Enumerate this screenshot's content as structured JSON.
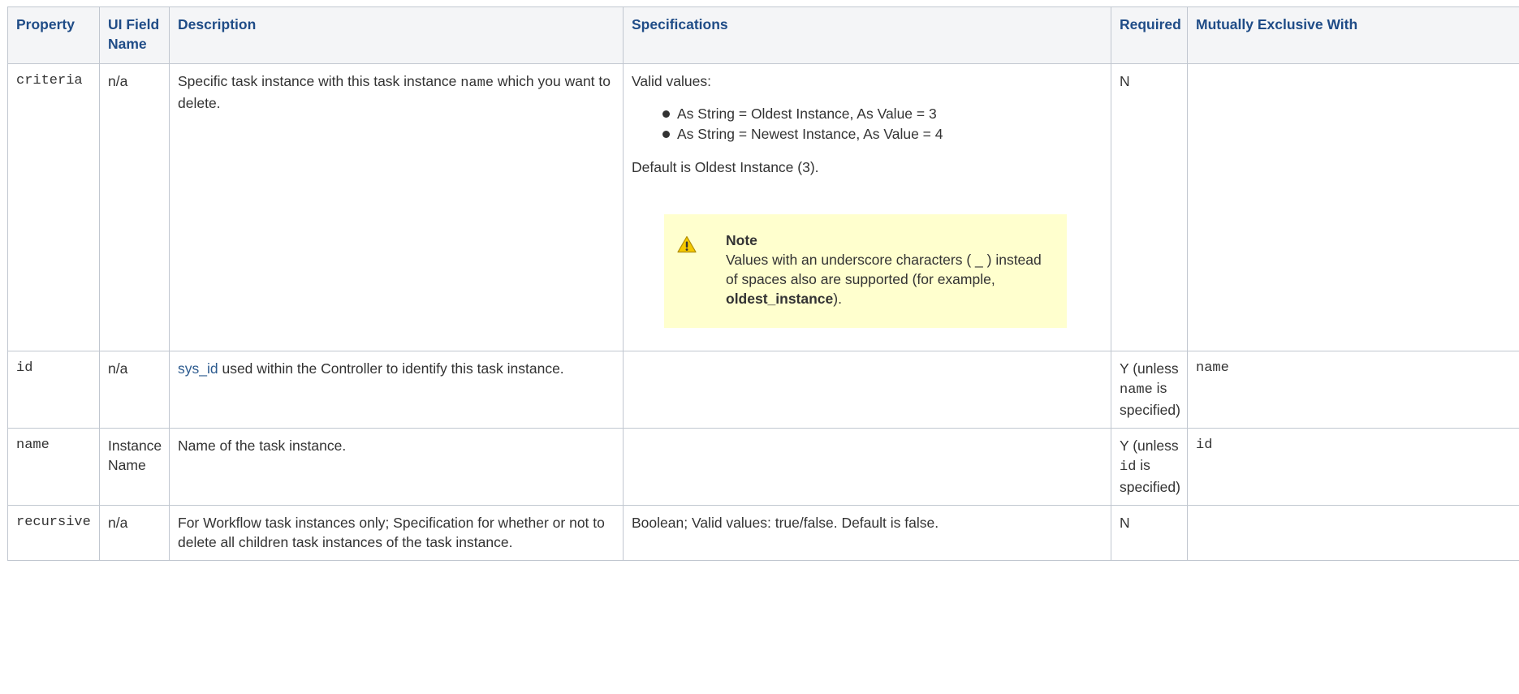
{
  "headers": {
    "property": "Property",
    "ui_field_name": "UI Field Name",
    "description": "Description",
    "specifications": "Specifications",
    "required": "Required",
    "mutually_exclusive": "Mutually Exclusive With"
  },
  "rows": [
    {
      "property": "criteria",
      "ui_field": "n/a",
      "desc_pre": "Specific task instance with this task instance ",
      "desc_code": "name",
      "desc_post": " which you want to delete.",
      "spec_intro": "Valid values:",
      "spec_items": [
        "As String = Oldest Instance, As Value = 3",
        "As String = Newest Instance, As Value = 4"
      ],
      "spec_default": "Default is Oldest Instance (3).",
      "note_title": "Note",
      "note_text_pre": "Values with an underscore characters ( _ ) instead of spaces also are supported (for example, ",
      "note_bold": "oldest_instance",
      "note_text_post": ").",
      "required": "N",
      "exclusive": ""
    },
    {
      "property": "id",
      "ui_field": "n/a",
      "desc_link": "sys_id",
      "desc_post": " used within the Controller to identify this task instance.",
      "spec": "",
      "required_pre": "Y (unless ",
      "required_code": "name",
      "required_post": " is specified)",
      "exclusive": "name"
    },
    {
      "property": "name",
      "ui_field": "Instance Name",
      "desc": "Name of the task instance.",
      "spec": "",
      "required_pre": "Y (unless ",
      "required_code": "id",
      "required_post": " is specified)",
      "exclusive": "id"
    },
    {
      "property": "recursive",
      "ui_field": "n/a",
      "desc": "For Workflow task instances only; Specification for whether or not to delete all children task instances of the task instance.",
      "spec": "Boolean; Valid values: true/false. Default is false.",
      "required": "N",
      "exclusive": ""
    }
  ],
  "icons": {
    "note": "warning-icon"
  },
  "colors": {
    "header_text": "#1f4c87",
    "header_bg": "#f4f5f7",
    "note_bg": "#ffffce",
    "link": "#2d5b8f"
  }
}
